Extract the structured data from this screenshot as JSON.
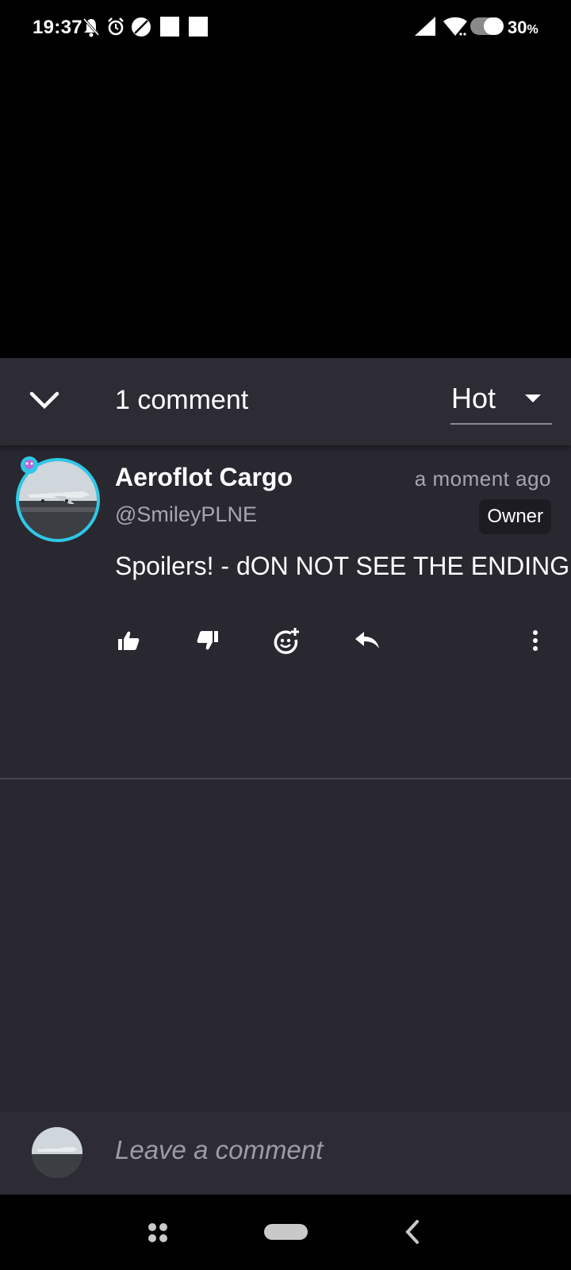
{
  "status_bar": {
    "time": "19:37",
    "battery": "30",
    "battery_unit": "%",
    "icons": [
      "mute-icon",
      "alarm-icon",
      "data-saver-icon",
      "notification-square-icon",
      "notification-square-icon",
      "signal-icon",
      "wifi-icon",
      "battery-icon"
    ]
  },
  "header": {
    "comment_count": "1 comment",
    "sort_value": "Hot"
  },
  "comment": {
    "author": "Aeroflot Cargo",
    "handle": "@SmileyPLNE",
    "timestamp": "a moment ago",
    "badge": "Owner",
    "text": "Spoilers! - dON NOT SEE THE ENDING",
    "actions": [
      "like-icon",
      "dislike-icon",
      "add-reaction-icon",
      "reply-icon",
      "more-options-icon"
    ]
  },
  "compose": {
    "placeholder": "Leave a comment"
  },
  "colors": {
    "panel_bg": "#29272f",
    "header_bg": "#2d2b33",
    "avatar_ring": "#2ec8e6",
    "muted_text": "#a8a5b0"
  }
}
